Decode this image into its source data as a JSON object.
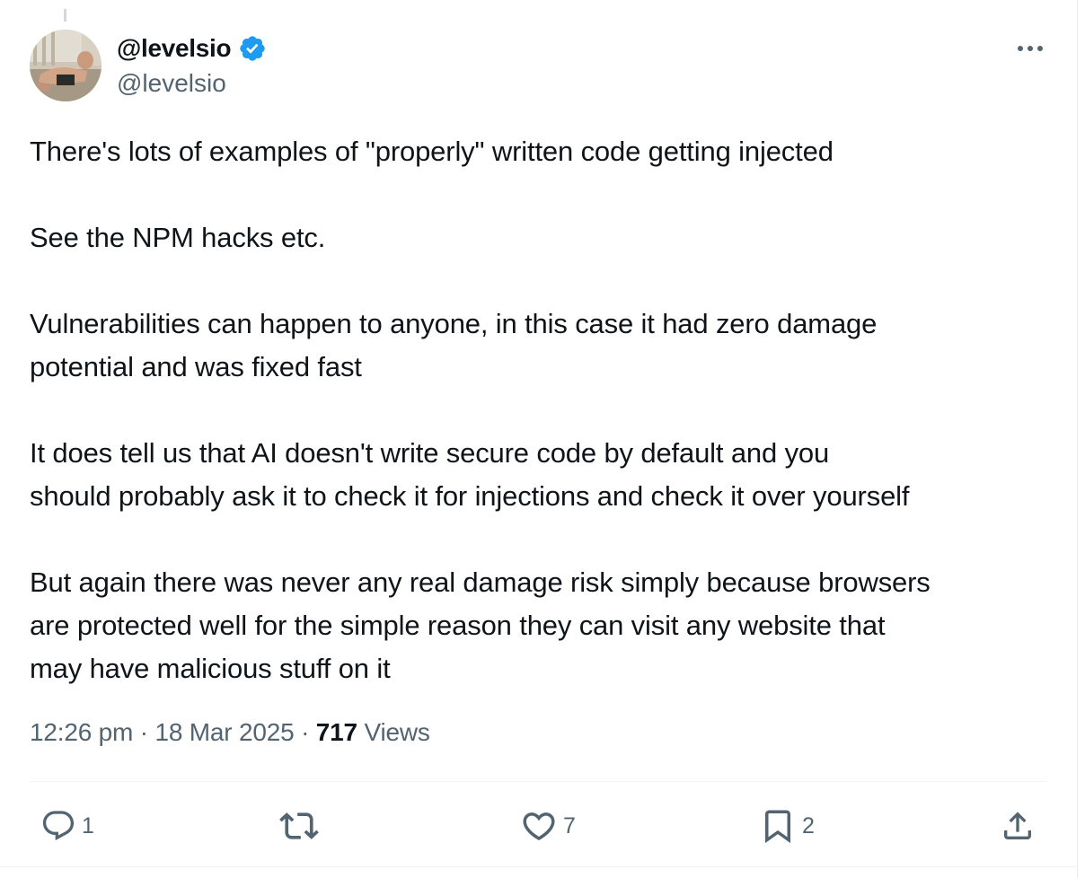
{
  "tweet": {
    "display_name": "@levelsio",
    "handle": "@levelsio",
    "body": [
      "There's lots of examples of \"properly\" written code getting injected",
      "See the NPM hacks etc.",
      "Vulnerabilities can happen to anyone, in this case it had zero damage",
      "potential and was fixed fast",
      "It does tell us that AI doesn't write secure code by default and you",
      "should probably ask it to check it for injections and check it over yourself",
      "But again there was never any real damage risk simply because browsers",
      "are protected well for the simple reason they can visit any website that",
      "may have malicious stuff on it"
    ],
    "time": "12:26 pm",
    "separator": "·",
    "date": "18 Mar 2025",
    "views_count": "717",
    "views_label": "Views"
  },
  "actions": {
    "reply_count": "1",
    "like_count": "7",
    "bookmark_count": "2"
  },
  "icons": {
    "verified": "verified-badge-icon",
    "more": "more-options-icon",
    "reply": "reply-icon",
    "retweet": "retweet-icon",
    "like": "heart-icon",
    "bookmark": "bookmark-icon",
    "share": "share-icon"
  },
  "colors": {
    "text_primary": "#0f1419",
    "text_secondary": "#536471",
    "verified_blue": "#1d9bf0",
    "divider": "#eff3f4"
  }
}
